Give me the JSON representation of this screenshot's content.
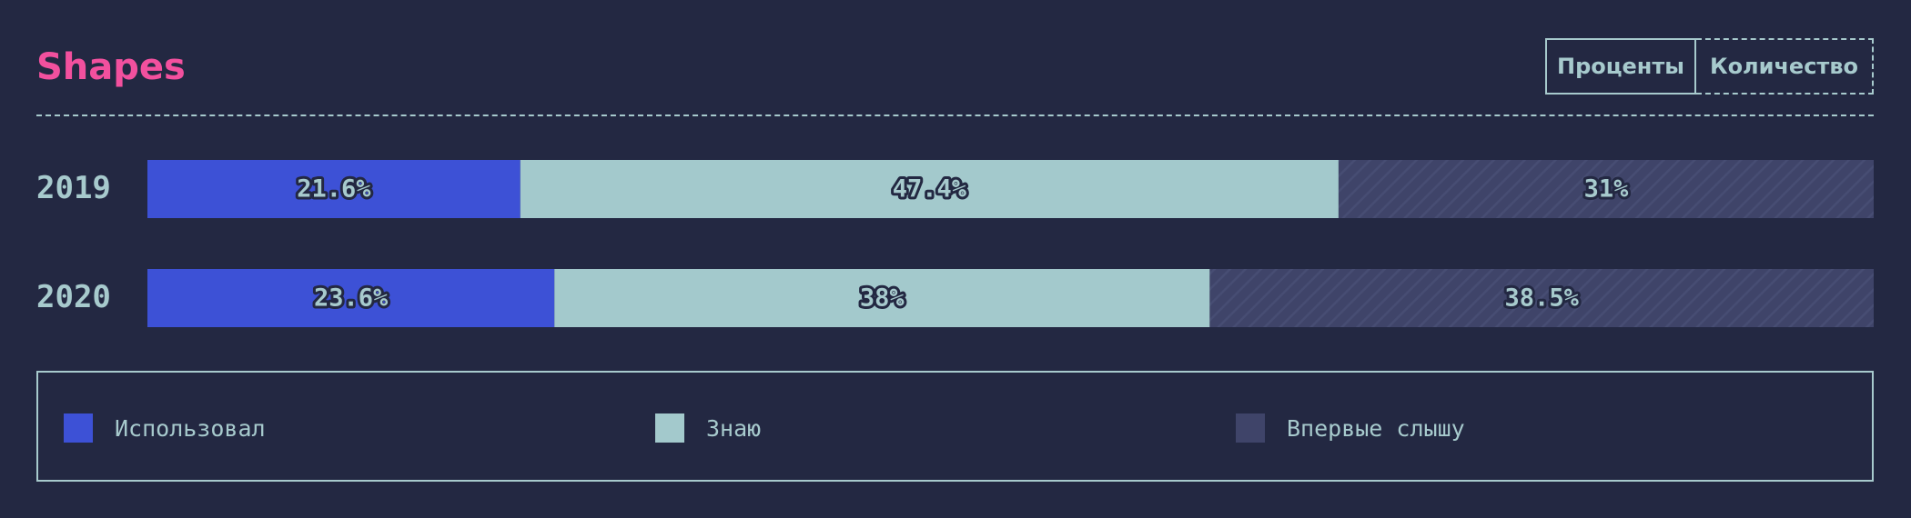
{
  "header": {
    "title": "Shapes",
    "toggle_percent": "Проценты",
    "toggle_count": "Количество"
  },
  "colors": {
    "background": "#232842",
    "title": "#f2509e",
    "text": "#a7cacd",
    "used": "#3d51d6",
    "know": "#a3c9cc",
    "never_heard": "#3f4469"
  },
  "chart_data": {
    "type": "bar",
    "orientation": "horizontal",
    "stacked": true,
    "categories": [
      "2019",
      "2020"
    ],
    "series": [
      {
        "name": "Использовал",
        "values": [
          21.6,
          23.6
        ],
        "labels": [
          "21.6%",
          "23.6%"
        ],
        "color": "#3d51d6",
        "pattern": "solid"
      },
      {
        "name": "Знаю",
        "values": [
          47.4,
          38
        ],
        "labels": [
          "47.4%",
          "38%"
        ],
        "color": "#a3c9cc",
        "pattern": "solid"
      },
      {
        "name": "Впервые слышу",
        "values": [
          31,
          38.5
        ],
        "labels": [
          "31%",
          "38.5%"
        ],
        "color": "#3f4469",
        "pattern": "hatched"
      }
    ],
    "xlim": [
      0,
      100
    ],
    "grid": false,
    "legend_position": "bottom"
  },
  "legend": [
    {
      "label": "Использовал",
      "color": "#3d51d6"
    },
    {
      "label": "Знаю",
      "color": "#a3c9cc"
    },
    {
      "label": "Впервые слышу",
      "color": "#3f4469"
    }
  ]
}
